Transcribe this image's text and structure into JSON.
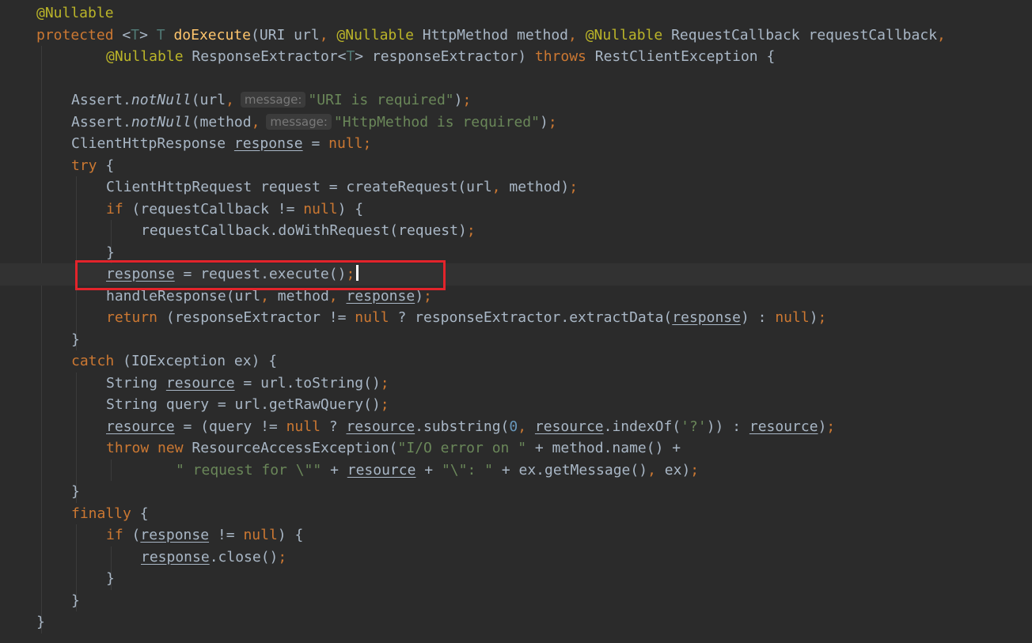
{
  "editor": {
    "lines": [
      {
        "t": [
          [
            "@Nullable",
            "ann"
          ]
        ]
      },
      {
        "t": [
          [
            "protected",
            "kw"
          ],
          [
            " <",
            ""
          ],
          [
            "T",
            "tp"
          ],
          [
            "> ",
            ""
          ],
          [
            "T",
            "tp"
          ],
          [
            " ",
            ""
          ],
          [
            "doExecute",
            "fn"
          ],
          [
            "(URI url",
            ""
          ],
          [
            ", ",
            "kw"
          ],
          [
            "@Nullable",
            "ann"
          ],
          [
            " HttpMethod method",
            ""
          ],
          [
            ", ",
            "kw"
          ],
          [
            "@Nullable",
            "ann"
          ],
          [
            " RequestCallback requestCallback",
            ""
          ],
          [
            ",",
            "kw"
          ]
        ]
      },
      {
        "t": [
          [
            "@Nullable",
            "ann"
          ],
          [
            " ResponseExtractor<",
            ""
          ],
          [
            "T",
            "tp"
          ],
          [
            "> responseExtractor) ",
            ""
          ],
          [
            "throws",
            "kw"
          ],
          [
            " RestClientException {",
            ""
          ]
        ]
      },
      {
        "t": []
      },
      {
        "t": [
          [
            "Assert.",
            ""
          ],
          [
            "notNull",
            "it"
          ],
          [
            "(url",
            ""
          ],
          [
            ",",
            "kw"
          ],
          [
            "message:",
            "hint"
          ],
          [
            "\"URI is required\"",
            "str"
          ],
          [
            ")",
            ""
          ],
          [
            ";",
            "kw"
          ]
        ]
      },
      {
        "t": [
          [
            "Assert.",
            ""
          ],
          [
            "notNull",
            "it"
          ],
          [
            "(method",
            ""
          ],
          [
            ",",
            "kw"
          ],
          [
            "message:",
            "hint"
          ],
          [
            "\"HttpMethod is required\"",
            "str"
          ],
          [
            ")",
            ""
          ],
          [
            ";",
            "kw"
          ]
        ]
      },
      {
        "t": [
          [
            "ClientHttpResponse ",
            ""
          ],
          [
            "response",
            "ul"
          ],
          [
            " = ",
            ""
          ],
          [
            "null",
            "kw"
          ],
          [
            ";",
            "kw"
          ]
        ]
      },
      {
        "t": [
          [
            "try",
            "kw"
          ],
          [
            " {",
            ""
          ]
        ]
      },
      {
        "t": [
          [
            "ClientHttpRequest request = createRequest(url",
            ""
          ],
          [
            ", ",
            "kw"
          ],
          [
            "method)",
            ""
          ],
          [
            ";",
            "kw"
          ]
        ]
      },
      {
        "t": [
          [
            "if",
            "kw"
          ],
          [
            " (requestCallback != ",
            ""
          ],
          [
            "null",
            "kw"
          ],
          [
            ") {",
            ""
          ]
        ]
      },
      {
        "t": [
          [
            "requestCallback.doWithRequest(request)",
            ""
          ],
          [
            ";",
            "kw"
          ]
        ]
      },
      {
        "t": [
          [
            "}",
            ""
          ]
        ]
      },
      {
        "t": [
          [
            "response",
            "ul"
          ],
          [
            " = request.execute()",
            ""
          ],
          [
            ";",
            "kw"
          ],
          [
            "",
            "caret"
          ]
        ]
      },
      {
        "t": [
          [
            "handleResponse(url",
            ""
          ],
          [
            ", ",
            "kw"
          ],
          [
            "method",
            ""
          ],
          [
            ", ",
            "kw"
          ],
          [
            "response",
            "ul"
          ],
          [
            ")",
            ""
          ],
          [
            ";",
            "kw"
          ]
        ]
      },
      {
        "t": [
          [
            "return",
            "kw"
          ],
          [
            " (responseExtractor != ",
            ""
          ],
          [
            "null",
            "kw"
          ],
          [
            " ? responseExtractor.extractData(",
            ""
          ],
          [
            "response",
            "ul"
          ],
          [
            ") : ",
            ""
          ],
          [
            "null",
            "kw"
          ],
          [
            ")",
            ""
          ],
          [
            ";",
            "kw"
          ]
        ]
      },
      {
        "t": [
          [
            "}",
            ""
          ]
        ]
      },
      {
        "t": [
          [
            "catch",
            "kw"
          ],
          [
            " (IOException ex) {",
            ""
          ]
        ]
      },
      {
        "t": [
          [
            "String ",
            ""
          ],
          [
            "resource",
            "ul"
          ],
          [
            " = url.toString()",
            ""
          ],
          [
            ";",
            "kw"
          ]
        ]
      },
      {
        "t": [
          [
            "String query = url.getRawQuery()",
            ""
          ],
          [
            ";",
            "kw"
          ]
        ]
      },
      {
        "t": [
          [
            "resource",
            "ul"
          ],
          [
            " = (query != ",
            ""
          ],
          [
            "null",
            "kw"
          ],
          [
            " ? ",
            ""
          ],
          [
            "resource",
            "ul"
          ],
          [
            ".substring(",
            ""
          ],
          [
            "0",
            "num"
          ],
          [
            ", ",
            "kw"
          ],
          [
            "resource",
            "ul"
          ],
          [
            ".indexOf(",
            ""
          ],
          [
            "'?'",
            "str"
          ],
          [
            ")) : ",
            ""
          ],
          [
            "resource",
            "ul"
          ],
          [
            ")",
            ""
          ],
          [
            ";",
            "kw"
          ]
        ]
      },
      {
        "t": [
          [
            "throw new",
            "kw"
          ],
          [
            " ResourceAccessException(",
            ""
          ],
          [
            "\"I/O error on \"",
            "str"
          ],
          [
            " + method.name() +",
            ""
          ]
        ]
      },
      {
        "t": [
          [
            "\" request for \\\"\"",
            "str"
          ],
          [
            " + ",
            ""
          ],
          [
            "resource",
            "ul"
          ],
          [
            " + ",
            ""
          ],
          [
            "\"\\\": \"",
            "str"
          ],
          [
            " + ex.getMessage()",
            ""
          ],
          [
            ", ",
            "kw"
          ],
          [
            "ex)",
            ""
          ],
          [
            ";",
            "kw"
          ]
        ]
      },
      {
        "t": [
          [
            "}",
            ""
          ]
        ]
      },
      {
        "t": [
          [
            "finally",
            "kw"
          ],
          [
            " {",
            ""
          ]
        ]
      },
      {
        "t": [
          [
            "if",
            "kw"
          ],
          [
            " (",
            ""
          ],
          [
            "response",
            "ul"
          ],
          [
            " != ",
            ""
          ],
          [
            "null",
            "kw"
          ],
          [
            ") {",
            ""
          ]
        ]
      },
      {
        "t": [
          [
            "response",
            "ul"
          ],
          [
            ".close()",
            ""
          ],
          [
            ";",
            "kw"
          ]
        ]
      },
      {
        "t": [
          [
            "}",
            ""
          ]
        ]
      },
      {
        "t": [
          [
            "}",
            ""
          ]
        ]
      },
      {
        "t": [
          [
            "}",
            ""
          ]
        ]
      }
    ],
    "current_line": 12,
    "highlighted_line": 12
  }
}
